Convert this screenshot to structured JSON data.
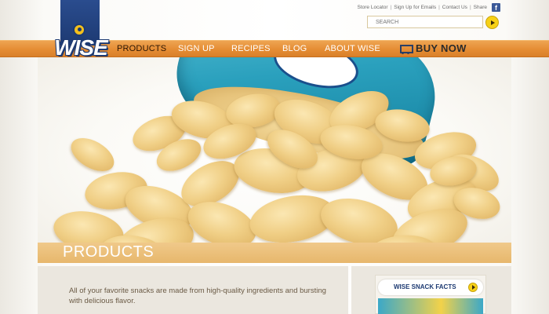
{
  "brand": {
    "logo_text": "WISE"
  },
  "header": {
    "links": [
      "Store Locator",
      "Sign Up for Emails",
      "Contact Us",
      "Share"
    ],
    "search_placeholder": "SEARCH"
  },
  "nav": {
    "items": [
      "PRODUCTS",
      "SIGN UP",
      "RECIPES",
      "BLOG",
      "ABOUT WISE"
    ],
    "buy_now": "BUY NOW"
  },
  "section": {
    "title": "PRODUCTS",
    "intro": "All of your favorite snacks are made from high-quality ingredients and bursting with delicious flavor."
  },
  "sidebar": {
    "facts_label": "WISE SNACK FACTS"
  },
  "colors": {
    "nav_orange": "#e58d34",
    "brand_blue": "#1d3a72",
    "accent_yellow": "#f7d117",
    "band_tan": "#e7b76c"
  }
}
